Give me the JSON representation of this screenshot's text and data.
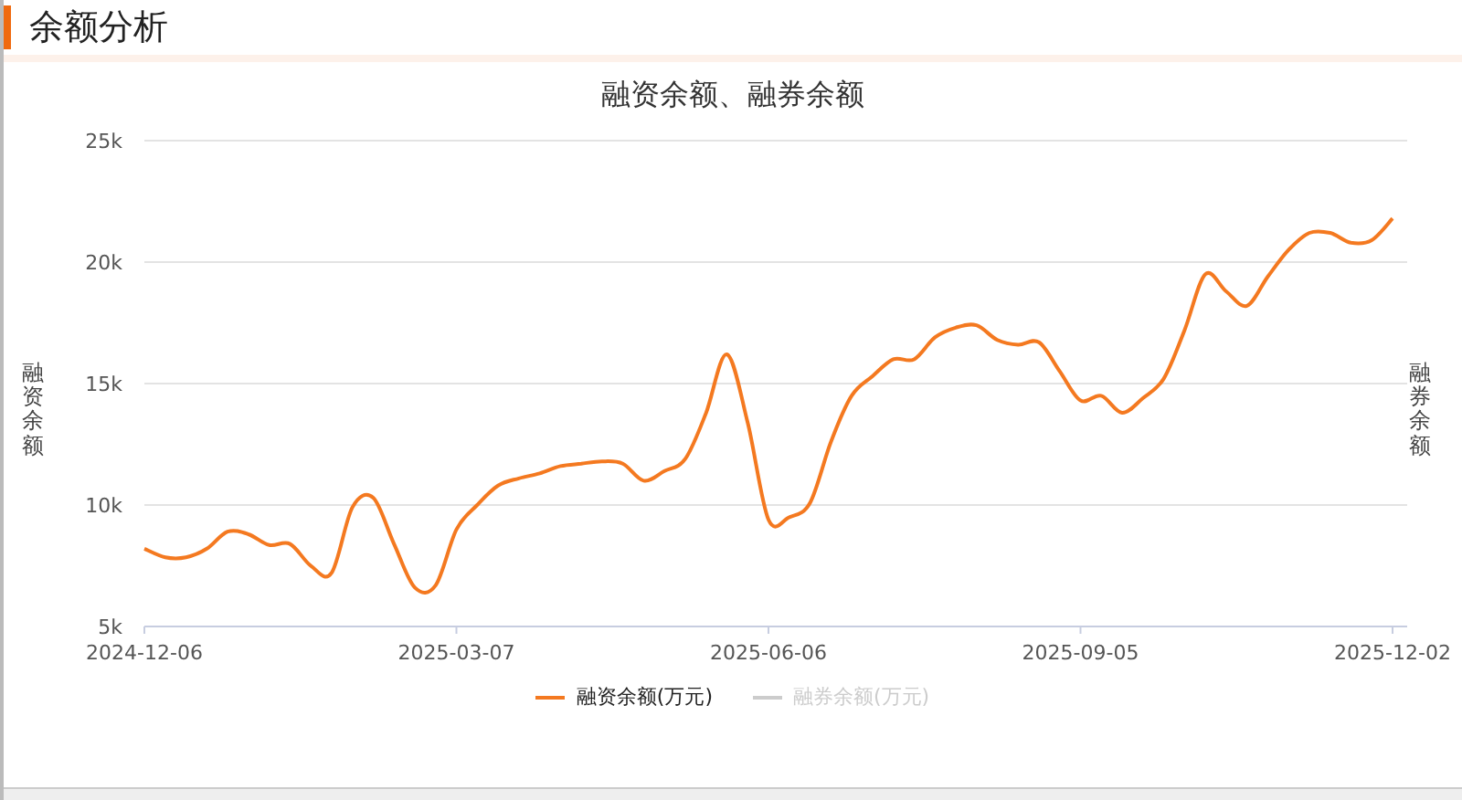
{
  "section": {
    "title": "余额分析"
  },
  "chart": {
    "right_axis_title": "融券余额",
    "legend": [
      {
        "selected": true
      },
      {
        "label": "融券余额(万元)",
        "selected": false
      }
    ],
    "chart_data": {
      "type": "line",
      "title": "融资余额、融券余额",
      "ylabel": "融资余额",
      "grid": true,
      "categories": [
        "2024-12-06",
        null,
        null,
        null,
        null,
        null,
        null,
        null,
        null,
        null,
        null,
        null,
        null,
        null,
        null,
        "2025-03-07",
        null,
        null,
        null,
        null,
        null,
        null,
        null,
        null,
        null,
        null,
        null,
        null,
        null,
        null,
        "2025-06-06",
        null,
        null,
        null,
        null,
        null,
        null,
        null,
        null,
        null,
        null,
        null,
        null,
        null,
        null,
        "2025-09-05",
        null,
        null,
        null,
        null,
        null,
        null,
        null,
        null,
        null,
        null,
        null,
        null,
        null,
        null,
        "2025-12-02"
      ],
      "series": [
        {
          "name": "融资余额(万元)",
          "color": "#f47920",
          "values": [
            8200,
            7850,
            7850,
            8200,
            8900,
            8800,
            8350,
            8400,
            7500,
            7200,
            9900,
            10300,
            8400,
            6600,
            6700,
            9000,
            10000,
            10800,
            11100,
            11300,
            11600,
            11700,
            11800,
            11700,
            11000,
            11400,
            11900,
            13800,
            16200,
            13400,
            9400,
            9500,
            10100,
            12600,
            14500,
            15300,
            16000,
            16000,
            16900,
            17300,
            17400,
            16800,
            16600,
            16700,
            15500,
            14300,
            14500,
            13800,
            14400,
            15200,
            17200,
            19500,
            18800,
            18200,
            19400,
            20500,
            21200,
            21200,
            20800,
            20900,
            21800
          ]
        }
      ],
      "ylim": [
        5000,
        25000
      ],
      "yticks": [
        {
          "value": 5000,
          "label": "5k"
        },
        {
          "value": 10000,
          "label": "10k"
        },
        {
          "value": 15000,
          "label": "15k"
        },
        {
          "value": 20000,
          "label": "20k"
        },
        {
          "value": 25000,
          "label": "25k"
        }
      ]
    }
  }
}
